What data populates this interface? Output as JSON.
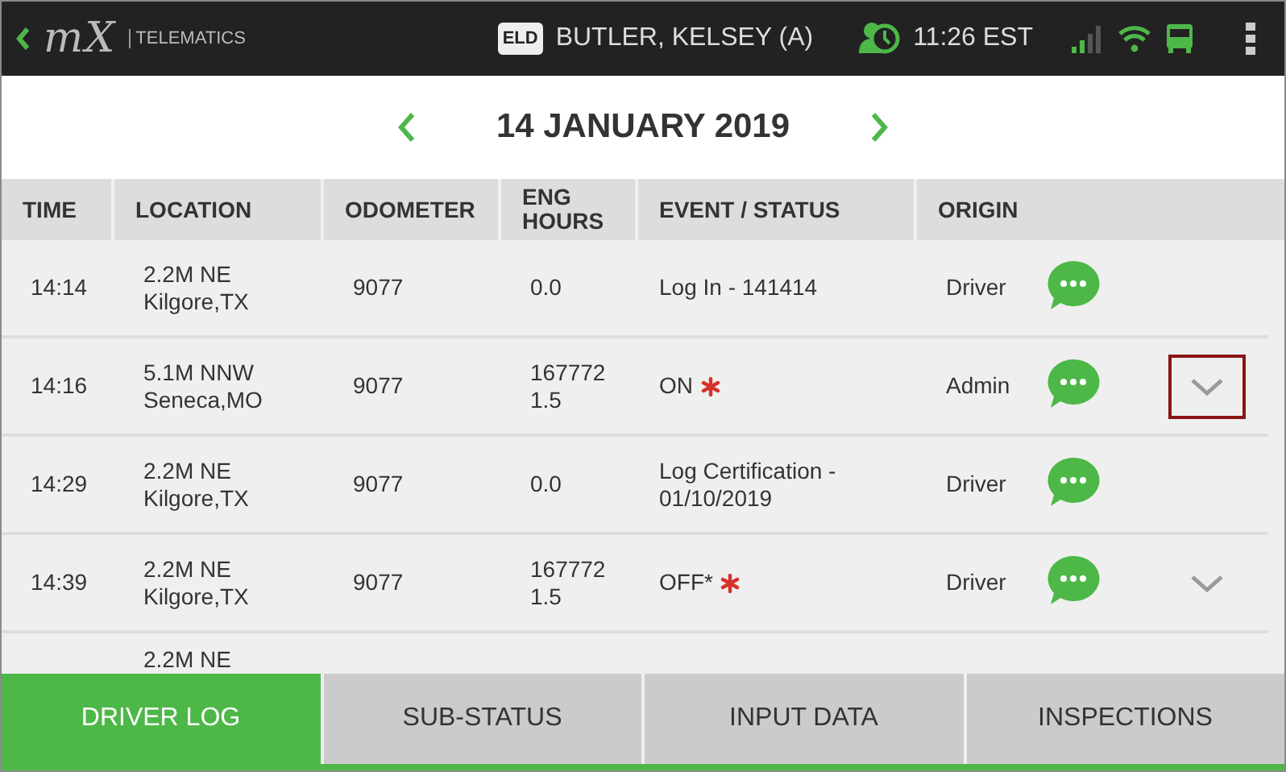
{
  "header": {
    "logo": "mX",
    "brand": "TELEMATICS",
    "eld_badge": "ELD",
    "driver": "BUTLER, KELSEY (A)",
    "time": "11:26 EST"
  },
  "date_nav": {
    "date": "14 JANUARY 2019"
  },
  "table": {
    "columns": [
      "TIME",
      "LOCATION",
      "ODOMETER",
      "ENG\nHOURS",
      "EVENT / STATUS",
      "ORIGIN"
    ],
    "rows": [
      {
        "time": "14:14",
        "location": "2.2M NE\nKilgore,TX",
        "odometer": "9077",
        "eng_hours": "0.0",
        "event": "Log In - 141414",
        "edited": false,
        "origin": "Driver",
        "expandable": false,
        "highlighted": false
      },
      {
        "time": "14:16",
        "location": "5.1M NNW\nSeneca,MO",
        "odometer": "9077",
        "eng_hours": "167772\n1.5",
        "event": "ON",
        "edited": true,
        "origin": "Admin",
        "expandable": true,
        "highlighted": true
      },
      {
        "time": "14:29",
        "location": "2.2M NE\nKilgore,TX",
        "odometer": "9077",
        "eng_hours": "0.0",
        "event": "Log Certification -\n01/10/2019",
        "edited": false,
        "origin": "Driver",
        "expandable": false,
        "highlighted": false
      },
      {
        "time": "14:39",
        "location": "2.2M NE\nKilgore,TX",
        "odometer": "9077",
        "eng_hours": "167772\n1.5",
        "event": "OFF*",
        "edited": true,
        "origin": "Driver",
        "expandable": true,
        "highlighted": false
      },
      {
        "location": "2.2M NE"
      }
    ]
  },
  "tabs": [
    {
      "label": "DRIVER LOG",
      "selected": true
    },
    {
      "label": "SUB-STATUS",
      "selected": false
    },
    {
      "label": "INPUT DATA",
      "selected": false
    },
    {
      "label": "INSPECTIONS",
      "selected": false
    }
  ]
}
